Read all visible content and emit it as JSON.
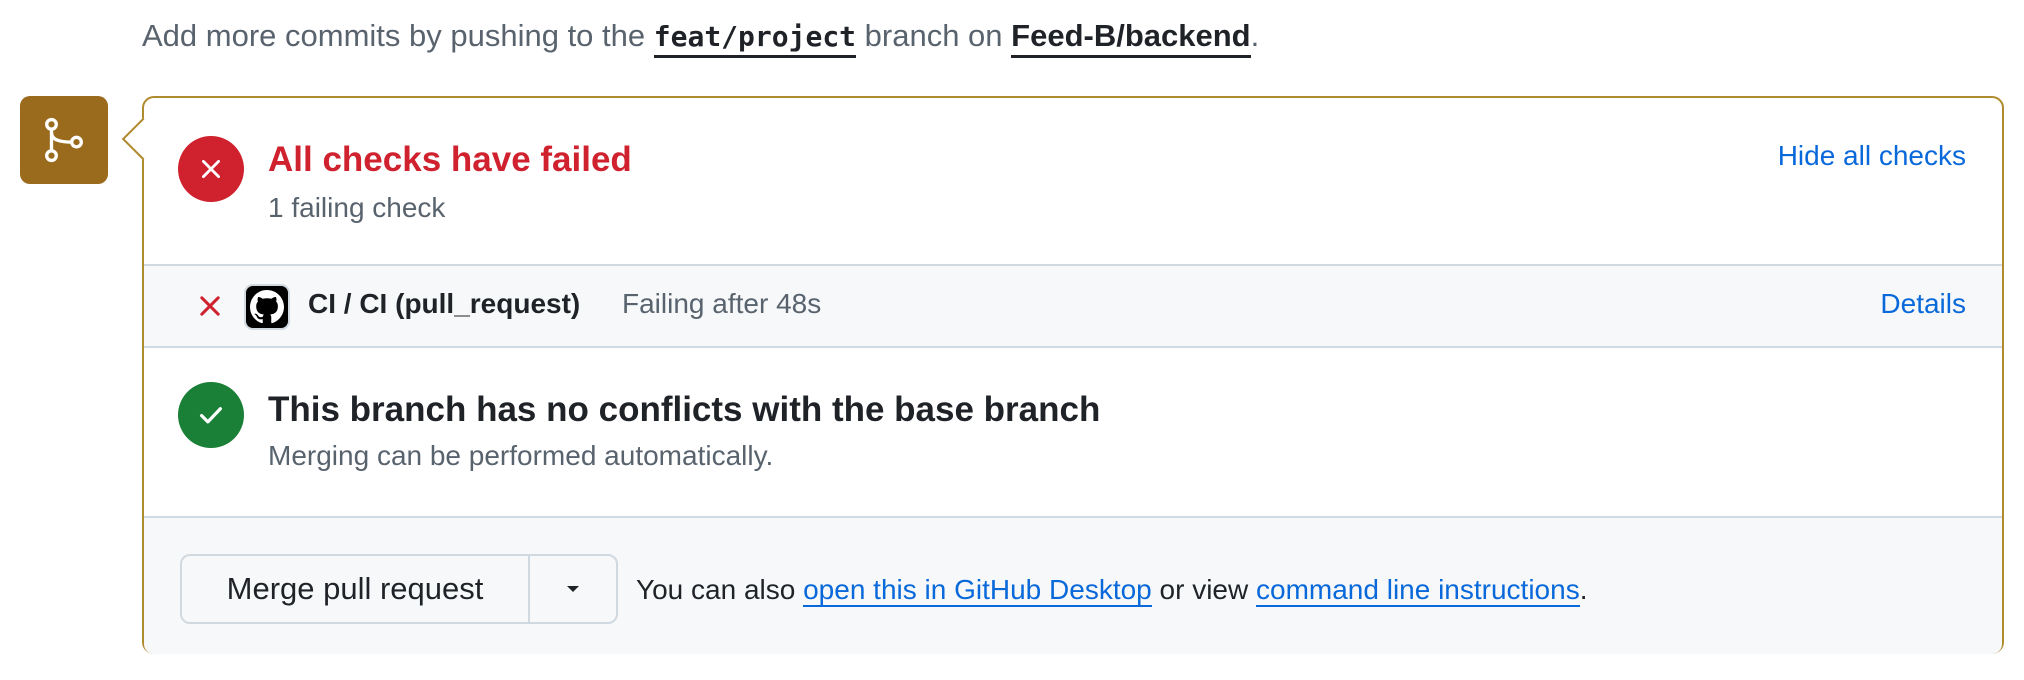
{
  "hint": {
    "prefix": "Add more commits by pushing to the ",
    "branch": "feat/project",
    "middle": " branch on ",
    "repo": "Feed-B/backend",
    "suffix": "."
  },
  "checks": {
    "title": "All checks have failed",
    "subtitle": "1 failing check",
    "hide_label": "Hide all checks",
    "items": [
      {
        "name": "CI / CI (pull_request)",
        "status": "Failing after 48s",
        "details_label": "Details",
        "state": "failed"
      }
    ]
  },
  "conflicts": {
    "title": "This branch has no conflicts with the base branch",
    "subtitle": "Merging can be performed automatically."
  },
  "merge": {
    "button_label": "Merge pull request",
    "also_prefix": "You can also ",
    "desktop_link": "open this in GitHub Desktop",
    "also_middle": " or view ",
    "cli_link": "command line instructions",
    "also_suffix": "."
  },
  "icons": {
    "merge_badge": "git-merge-icon",
    "fail": "x-circle-icon",
    "ok": "check-circle-icon",
    "check_state": "x-icon",
    "app_avatar": "github-icon",
    "dropdown": "triangle-down-icon"
  },
  "colors": {
    "danger": "#cf222e",
    "success": "#1a7f37",
    "link": "#0969da",
    "attention_border": "#b08a2e",
    "merge_badge_bg": "#9a6a1d"
  }
}
